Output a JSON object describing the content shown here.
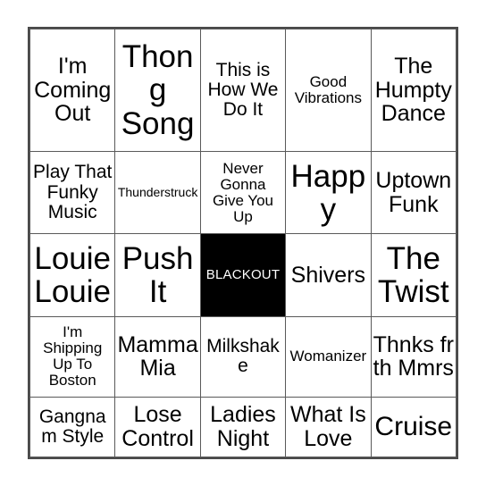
{
  "card": {
    "type": "bingo-card",
    "rows": 5,
    "columns": 5,
    "border_color": "#4a4a4a",
    "gridline_color": "#5a5a5a",
    "background_color": "#ffffff",
    "text_color": "#000000",
    "free_space": {
      "label": "BLACKOUT",
      "row": 3,
      "column": 3,
      "background_color": "#000000",
      "text_color": "#ffffff"
    },
    "cells": [
      [
        {
          "text": "I'm Coming Out",
          "size": "md"
        },
        {
          "text": "Thong Song",
          "size": "xl"
        },
        {
          "text": "This is How We Do It",
          "size": "sm"
        },
        {
          "text": "Good Vibrations",
          "size": "xs"
        },
        {
          "text": "The Humpty Dance",
          "size": "md"
        }
      ],
      [
        {
          "text": "Play That Funky Music",
          "size": "sm"
        },
        {
          "text": "Thunderstruck",
          "size": "xxs"
        },
        {
          "text": "Never Gonna Give You Up",
          "size": "xs"
        },
        {
          "text": "Happy",
          "size": "xl"
        },
        {
          "text": "Uptown Funk",
          "size": "md"
        }
      ],
      [
        {
          "text": "Louie Louie",
          "size": "xl"
        },
        {
          "text": "Push It",
          "size": "xl"
        },
        {
          "text": "BLACKOUT",
          "size": "free"
        },
        {
          "text": "Shivers",
          "size": "md"
        },
        {
          "text": "The Twist",
          "size": "xl"
        }
      ],
      [
        {
          "text": "I'm Shipping Up To Boston",
          "size": "xs"
        },
        {
          "text": "Mamma Mia",
          "size": "md"
        },
        {
          "text": "Milkshake",
          "size": "sm"
        },
        {
          "text": "Womanizer",
          "size": "xs"
        },
        {
          "text": "Thnks fr th Mmrs",
          "size": "md"
        }
      ],
      [
        {
          "text": "Gangnam Style",
          "size": "sm"
        },
        {
          "text": "Lose Control",
          "size": "md"
        },
        {
          "text": "Ladies Night",
          "size": "md"
        },
        {
          "text": "What Is Love",
          "size": "md"
        },
        {
          "text": "Cruise",
          "size": "lg"
        }
      ]
    ]
  }
}
